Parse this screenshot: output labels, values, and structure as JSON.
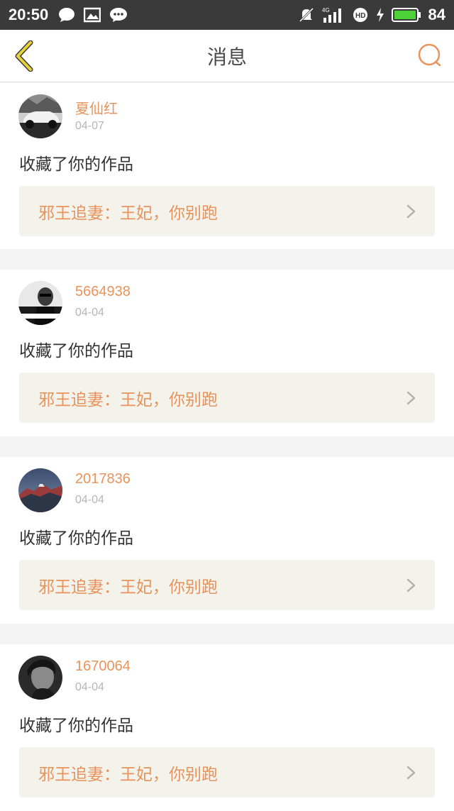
{
  "status_bar": {
    "time": "20:50",
    "battery": "84",
    "icons": [
      "chat-bubble-icon",
      "image-icon",
      "wechat-icon",
      "mute-icon",
      "signal-4g-icon",
      "hd-icon",
      "charging-icon",
      "battery-icon"
    ]
  },
  "header": {
    "title": "消息",
    "back_icon": "back-chevron-icon",
    "search_icon": "search-icon"
  },
  "colors": {
    "accent": "#e8935c",
    "back_icon": "#e8d23a",
    "link_bg": "#f3f3ec"
  },
  "messages": [
    {
      "name": "夏仙红",
      "date": "04-07",
      "text": "收藏了你的作品",
      "work": "邪王追妻：王妃，你别跑"
    },
    {
      "name": "5664938",
      "date": "04-04",
      "text": "收藏了你的作品",
      "work": "邪王追妻：王妃，你别跑"
    },
    {
      "name": "2017836",
      "date": "04-04",
      "text": "收藏了你的作品",
      "work": "邪王追妻：王妃，你别跑"
    },
    {
      "name": "1670064",
      "date": "04-04",
      "text": "收藏了你的作品",
      "work": "邪王追妻：王妃，你别跑"
    }
  ]
}
